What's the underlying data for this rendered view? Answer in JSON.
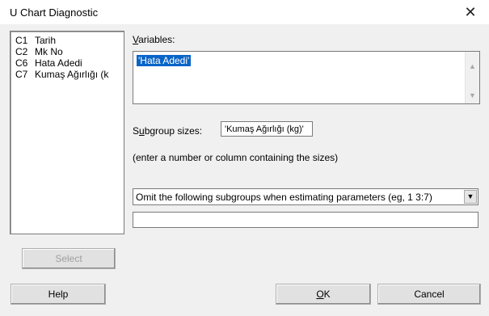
{
  "window": {
    "title": "U Chart Diagnostic",
    "close_glyph": "✕"
  },
  "columns": [
    {
      "id": "C1",
      "name": "Tarih"
    },
    {
      "id": "C2",
      "name": "Mk No"
    },
    {
      "id": "C6",
      "name": "Hata Adedi"
    },
    {
      "id": "C7",
      "name": "Kumaş Ağırlığı (k"
    }
  ],
  "variables": {
    "label_underlined": "V",
    "label_rest": "ariables:",
    "value": "'Hata Adedi'"
  },
  "subgroup": {
    "label_pre": "S",
    "label_underlined": "u",
    "label_rest": "bgroup sizes:",
    "value": "'Kumaş Ağırlığı (kg)'",
    "hint": "(enter a number or column containing the sizes)"
  },
  "omit": {
    "selected": "Omit the following subgroups when estimating parameters (eg, 1 3:7)",
    "value": ""
  },
  "buttons": {
    "select": "Select",
    "help": "Help",
    "ok_underlined": "O",
    "ok_rest": "K",
    "cancel": "Cancel"
  }
}
